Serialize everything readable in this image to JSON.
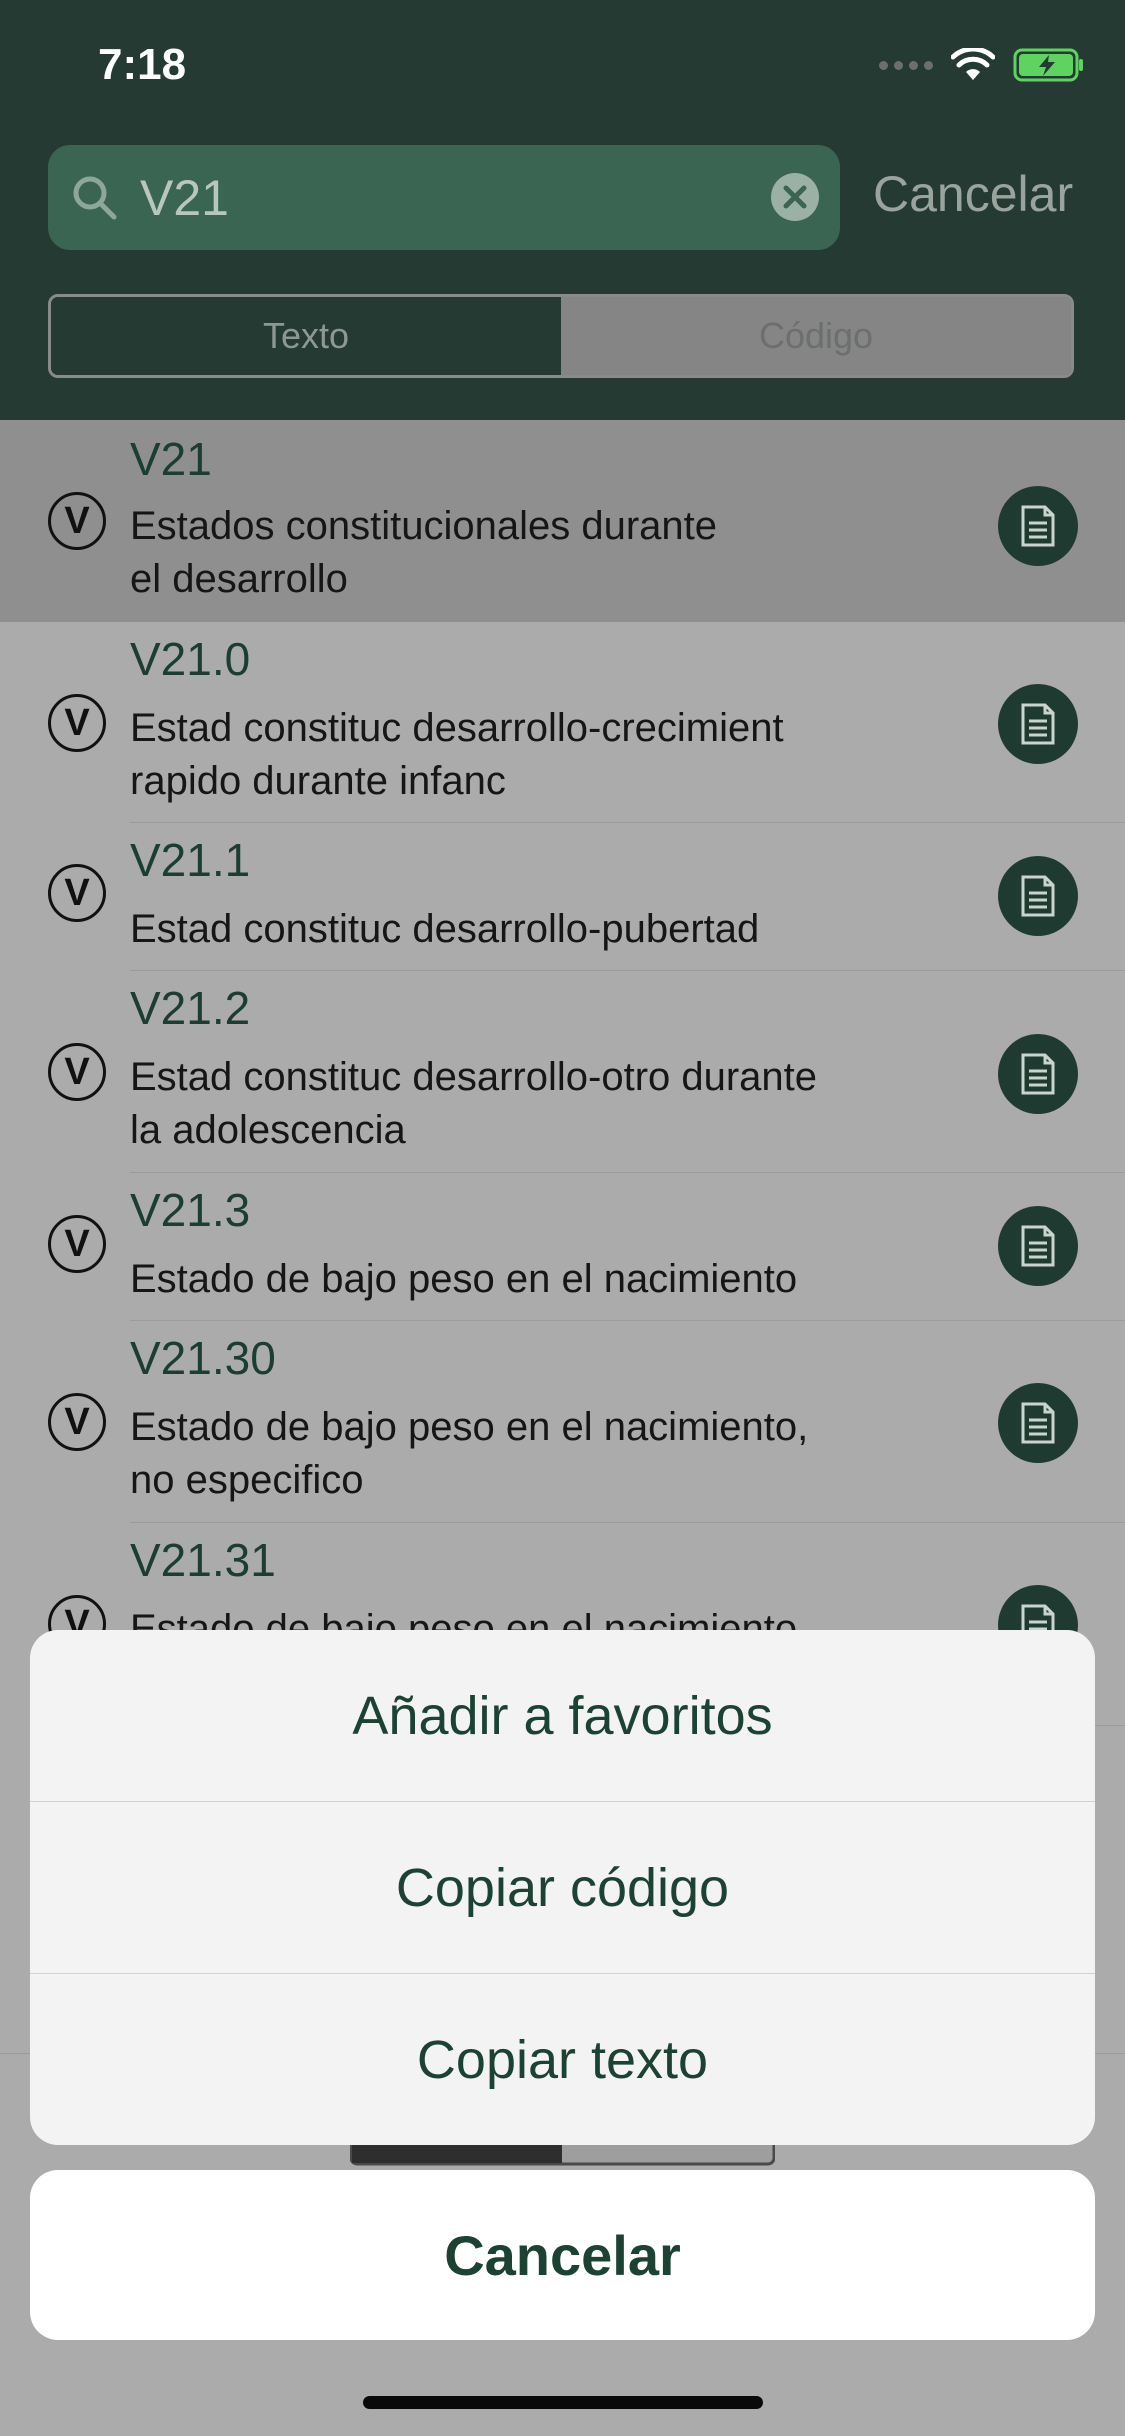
{
  "status_bar": {
    "time": "7:18"
  },
  "search": {
    "query": "V21",
    "cancel_label": "Cancelar"
  },
  "segments": [
    {
      "label": "Texto"
    },
    {
      "label": "Código"
    }
  ],
  "results": [
    {
      "code": "V21",
      "desc": [
        "Estados constitucionales durante",
        "el desarrollo"
      ]
    },
    {
      "code": "V21.0",
      "desc": [
        "Estad constituc desarrollo-crecimient",
        "rapido durante infanc"
      ]
    },
    {
      "code": "V21.1",
      "desc": [
        "Estad constituc desarrollo-pubertad"
      ]
    },
    {
      "code": "V21.2",
      "desc": [
        "Estad constituc desarrollo-otro durante",
        "la adolescencia"
      ]
    },
    {
      "code": "V21.3",
      "desc": [
        "Estado de bajo peso en el nacimiento"
      ]
    },
    {
      "code": "V21.30",
      "desc": [
        "Estado de bajo peso en el nacimiento,",
        "no especifico"
      ]
    },
    {
      "code": "V21.31",
      "desc": [
        "Estado de bajo peso en el nacimiento"
      ]
    }
  ],
  "badge_letter": "V",
  "action_sheet": {
    "items": [
      "Añadir a favoritos",
      "Copiar código",
      "Copiar texto"
    ],
    "cancel": "Cancelar"
  },
  "colors": {
    "header": "#253a33",
    "accent": "#1b4233",
    "search_field": "#3b6553"
  }
}
